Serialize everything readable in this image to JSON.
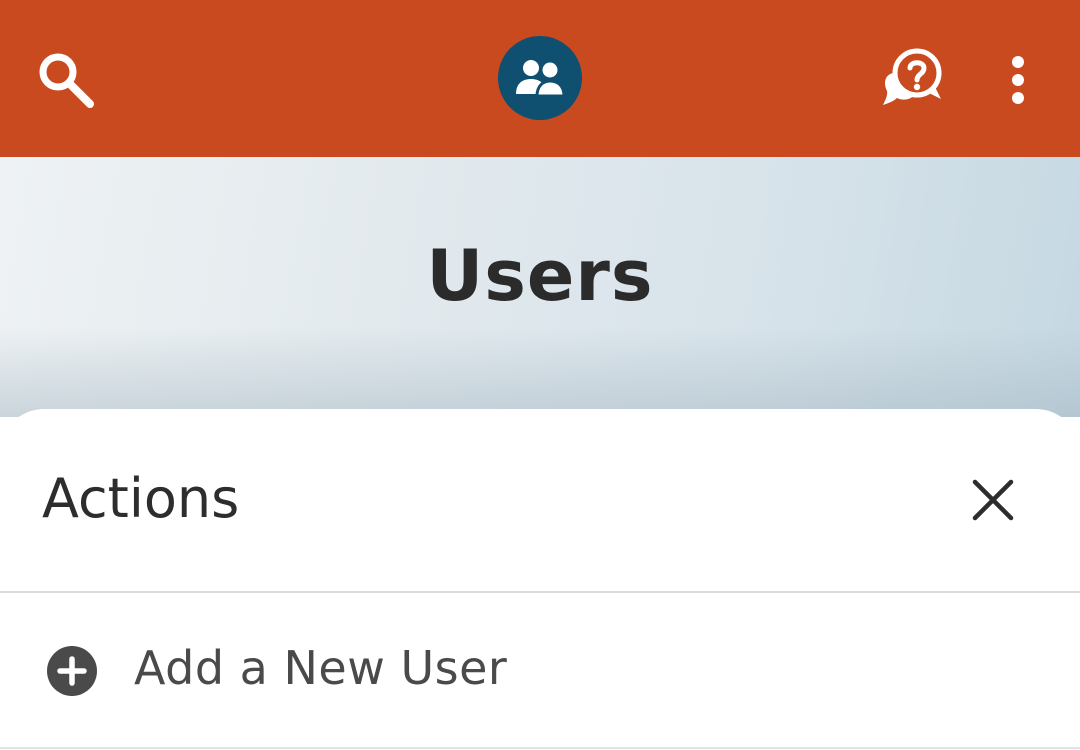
{
  "topbar": {
    "background": "#c94a1f",
    "icons": {
      "search": "search-icon",
      "users": "users-icon",
      "help": "help-chat-icon",
      "more": "more-vertical-icon"
    },
    "users_badge_color": "#0f4f6f"
  },
  "hero": {
    "title": "Users"
  },
  "actions_sheet": {
    "title": "Actions",
    "close_icon": "close-icon",
    "items": [
      {
        "label": "Add a New User",
        "icon": "add-circle-icon"
      }
    ]
  }
}
